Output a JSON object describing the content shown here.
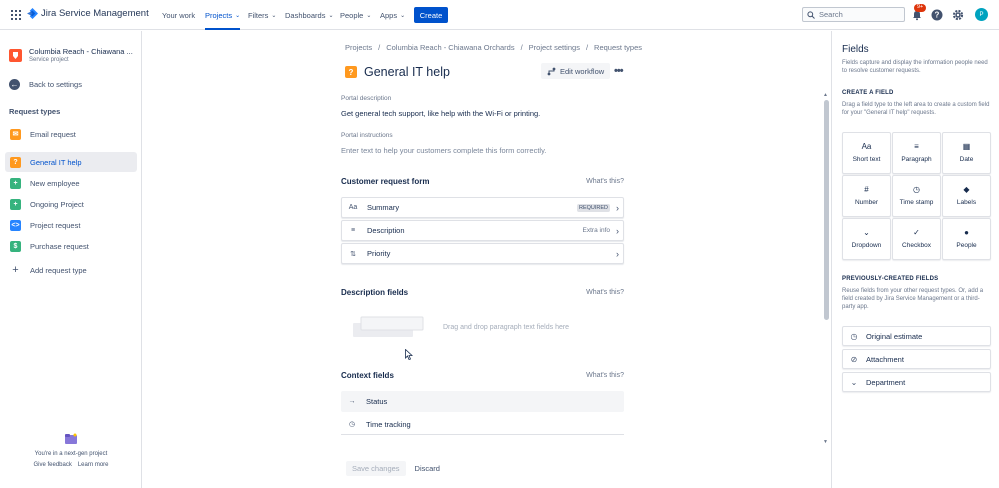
{
  "topbar": {
    "logo_text": "Jira Service Management",
    "nav": [
      {
        "label": "Your work",
        "dropdown": false
      },
      {
        "label": "Projects",
        "dropdown": true,
        "active": true
      },
      {
        "label": "Filters",
        "dropdown": true
      },
      {
        "label": "Dashboards",
        "dropdown": true
      },
      {
        "label": "People",
        "dropdown": true
      },
      {
        "label": "Apps",
        "dropdown": true
      }
    ],
    "create_label": "Create",
    "search_placeholder": "Search",
    "notification_badge": "9+",
    "avatar_initial": "P",
    "accent_color": "#0052cc"
  },
  "sidebar": {
    "project_name": "Columbia Reach - Chiawana ...",
    "project_type": "Service project",
    "back_label": "Back to settings",
    "section_title": "Request types",
    "items": [
      {
        "label": "Email request",
        "icon": "email-icon",
        "color": "#ff991f",
        "selected": false
      },
      {
        "label": "General IT help",
        "icon": "question-icon",
        "color": "#ff991f",
        "selected": true
      },
      {
        "label": "New employee",
        "icon": "plus-icon",
        "color": "#36b37e",
        "selected": false
      },
      {
        "label": "Ongoing Project",
        "icon": "plus-icon",
        "color": "#36b37e",
        "selected": false
      },
      {
        "label": "Project request",
        "icon": "code-icon",
        "color": "#2684ff",
        "selected": false
      },
      {
        "label": "Purchase request",
        "icon": "dollar-icon",
        "color": "#36b37e",
        "selected": false
      }
    ],
    "add_label": "Add request type",
    "nextgen_text": "You're in a next-gen project",
    "feedback_label": "Give feedback",
    "learn_label": "Learn more"
  },
  "main": {
    "breadcrumbs": [
      "Projects",
      "/",
      "Columbia Reach - Chiawana Orchards",
      "/",
      "Project settings",
      "/",
      "Request types"
    ],
    "title": "General IT help",
    "edit_workflow_label": "Edit workflow",
    "portal_description_label": "Portal description",
    "portal_description_value": "Get general tech support, like help with the Wi-Fi or printing.",
    "portal_instructions_label": "Portal instructions",
    "portal_instructions_placeholder": "Enter text to help your customers complete this form correctly.",
    "whats_this": "What's this?",
    "customer_form_title": "Customer request form",
    "form_fields": [
      {
        "label": "Summary",
        "icon": "Aa",
        "tag": "REQUIRED"
      },
      {
        "label": "Description",
        "icon": "≡",
        "tag_plain": "Extra info"
      },
      {
        "label": "Priority",
        "icon": "⇅"
      }
    ],
    "description_fields_title": "Description fields",
    "drop_hint": "Drag and drop paragraph text fields here",
    "context_fields_title": "Context fields",
    "context_fields": [
      {
        "label": "Status",
        "icon": "→"
      },
      {
        "label": "Time tracking",
        "icon": "◷"
      }
    ],
    "save_label": "Save changes",
    "discard_label": "Discard"
  },
  "panel": {
    "title": "Fields",
    "description": "Fields capture and display the information people need to resolve customer requests.",
    "create_heading": "CREATE A FIELD",
    "create_desc": "Drag a field type to the left area to create a custom field for your \"General IT help\" requests.",
    "field_types": [
      {
        "label": "Short text",
        "icon": "Aa"
      },
      {
        "label": "Paragraph",
        "icon": "≡"
      },
      {
        "label": "Date",
        "icon": "▦"
      },
      {
        "label": "Number",
        "icon": "#"
      },
      {
        "label": "Time stamp",
        "icon": "◷"
      },
      {
        "label": "Labels",
        "icon": "◆"
      },
      {
        "label": "Dropdown",
        "icon": "⌄"
      },
      {
        "label": "Checkbox",
        "icon": "✓"
      },
      {
        "label": "People",
        "icon": "●"
      }
    ],
    "previous_heading": "PREVIOUSLY-CREATED FIELDS",
    "previous_desc": "Reuse fields from your other request types. Or, add a field created by Jira Service Management or a third-party app.",
    "previous_fields": [
      {
        "label": "Original estimate",
        "icon": "◷"
      },
      {
        "label": "Attachment",
        "icon": "⊘"
      },
      {
        "label": "Department",
        "icon": "⌄"
      }
    ]
  }
}
